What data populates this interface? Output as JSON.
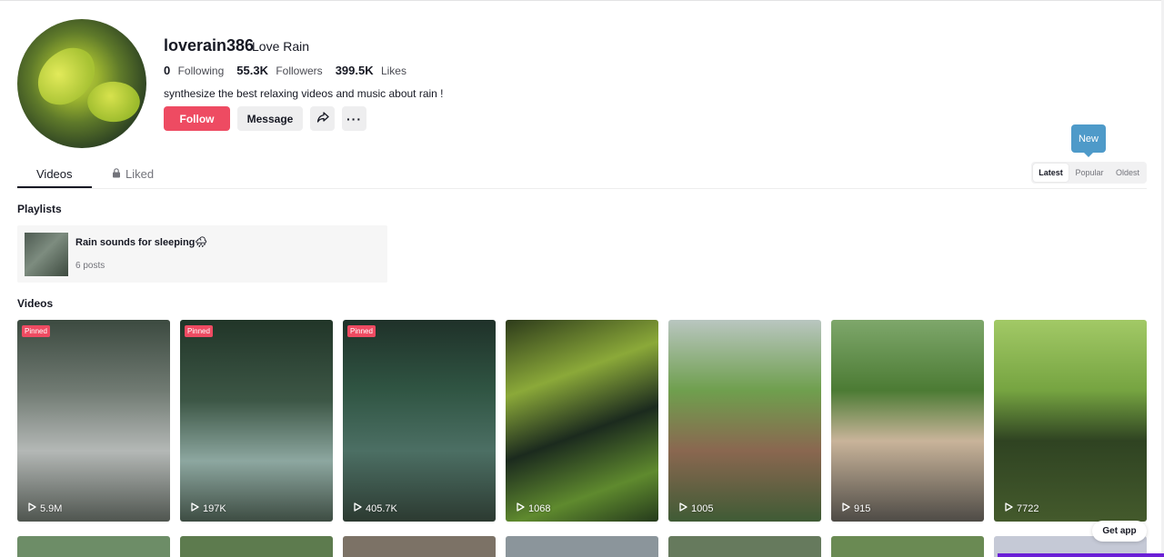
{
  "profile": {
    "username": "loverain386",
    "nickname": "Love Rain",
    "stats": [
      {
        "value": "0",
        "label": "Following"
      },
      {
        "value": "55.3K",
        "label": "Followers"
      },
      {
        "value": "399.5K",
        "label": "Likes"
      }
    ],
    "bio": "synthesize the best relaxing videos and music about rain !",
    "follow_label": "Follow",
    "message_label": "Message",
    "share_icon": "share-icon",
    "more_icon": "more-icon",
    "more_label": "···"
  },
  "tabs": {
    "videos": "Videos",
    "liked": "Liked"
  },
  "sort": {
    "tooltip": "New",
    "options": [
      "Latest",
      "Popular",
      "Oldest"
    ],
    "selected": "Latest"
  },
  "playlists": {
    "heading": "Playlists",
    "items": [
      {
        "title": "Rain sounds for sleeping🌧",
        "count": "6 posts"
      }
    ]
  },
  "videos": {
    "heading": "Videos",
    "pinned_label": "Pinned",
    "items": [
      {
        "views": "5.9M",
        "pinned": true
      },
      {
        "views": "197K",
        "pinned": true
      },
      {
        "views": "405.7K",
        "pinned": true
      },
      {
        "views": "1068",
        "pinned": false
      },
      {
        "views": "1005",
        "pinned": false
      },
      {
        "views": "915",
        "pinned": false
      },
      {
        "views": "7722",
        "pinned": false
      }
    ]
  },
  "get_app_label": "Get app",
  "colors": {
    "accent": "#ee4b62",
    "tooltip": "#4e9ac9",
    "text": "#161823"
  }
}
